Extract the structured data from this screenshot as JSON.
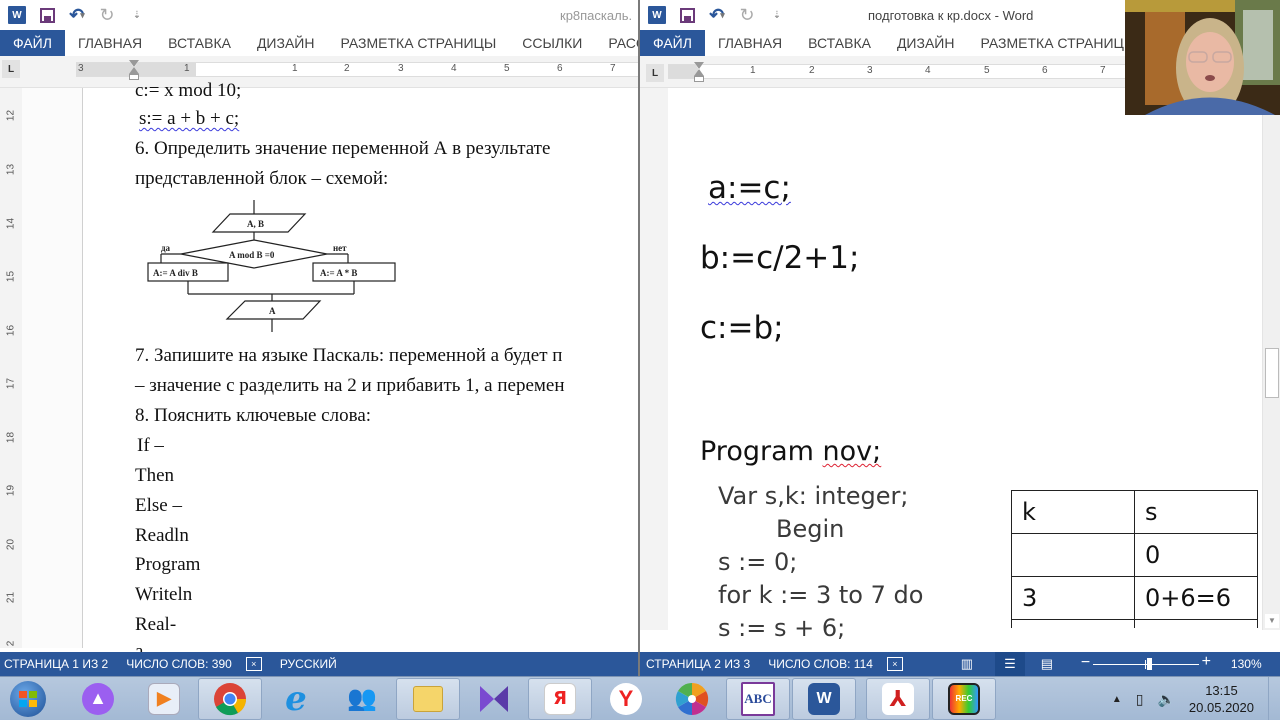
{
  "left_window": {
    "title": "кр8паскаль.",
    "ribbon_tabs": [
      "ФАЙЛ",
      "ГЛАВНАЯ",
      "ВСТАВКА",
      "ДИЗАЙН",
      "РАЗМЕТКА СТРАНИЦЫ",
      "ССЫЛКИ",
      "РАСС"
    ],
    "ruler_numbers": [
      "3",
      "1",
      "1",
      "2",
      "3",
      "4",
      "5",
      "6",
      "7"
    ],
    "vruler_numbers": [
      "12",
      "13",
      "14",
      "15",
      "16",
      "17",
      "18",
      "19",
      "20",
      "21",
      "2"
    ],
    "document": {
      "lines": [
        "c:= x mod 10;",
        "s:= a + b + c;",
        "6. Определить значение переменной А в результате",
        "представленной блок – схемой:",
        "7. Запишите на языке Паскаль: переменной a будет п",
        "– значение c разделить на 2 и прибавить 1, а перемен",
        " 8. Пояснить ключевые слова:",
        " If –",
        "Then",
        "Else –",
        "Readln",
        "Program",
        "Writeln",
        "Real-",
        "a"
      ],
      "flowchart": {
        "input": "A, B",
        "condition": "A mod B =0",
        "yes_label": "да",
        "no_label": "нет",
        "yes_action": "A:= A div B",
        "no_action": "A:= A * B",
        "output": "A"
      }
    },
    "status": {
      "page": "СТРАНИЦА 1 ИЗ 2",
      "words": "ЧИСЛО СЛОВ: 390",
      "proofing_icon": "proofing-icon",
      "language": "РУССКИЙ"
    }
  },
  "right_window": {
    "title": "подготовка к кр.docx - Word",
    "ribbon_tabs": [
      "ФАЙЛ",
      "ГЛАВНАЯ",
      "ВСТАВКА",
      "ДИЗАЙН",
      "РАЗМЕТКА СТРАНИЦЫ"
    ],
    "ruler_numbers": [
      "1",
      "2",
      "3",
      "4",
      "5",
      "6",
      "7"
    ],
    "document": {
      "assignments": [
        "a:=c;",
        "b:=c/2+1;",
        "c:=b;"
      ],
      "program_line_keyword": "Program",
      "program_line_name": "nov;",
      "code_lines": [
        "Var s,k: integer;",
        "Begin",
        "s := 0;",
        "for k := 3 to 7 do",
        "s := s + 6;"
      ],
      "trace_table": {
        "headers": [
          "k",
          "s"
        ],
        "rows": [
          [
            "",
            "0"
          ],
          [
            "3",
            "0+6=6"
          ]
        ]
      }
    },
    "status": {
      "page": "СТРАНИЦА 2 ИЗ 3",
      "words": "ЧИСЛО СЛОВ: 114",
      "zoom": "130%",
      "zoom_minus": "−",
      "zoom_plus": "+"
    }
  },
  "taskbar": {
    "apps": [
      "start",
      "alice",
      "media-player",
      "chrome",
      "internet-explorer",
      "messenger",
      "explorer",
      "kmplayer",
      "yandex-browser",
      "yandex",
      "photo",
      "abc",
      "word",
      "acrobat",
      "screen-recorder"
    ],
    "abc_label": "ABC",
    "word_label": "W",
    "rec_label": "REC",
    "yandex_label": "Я",
    "y_label": "Y",
    "clock_time": "13:15",
    "clock_date": "20.05.2020"
  },
  "quick_access": {
    "word_label": "W",
    "undo": "↶",
    "redo": "↻",
    "customize": "⇣"
  }
}
